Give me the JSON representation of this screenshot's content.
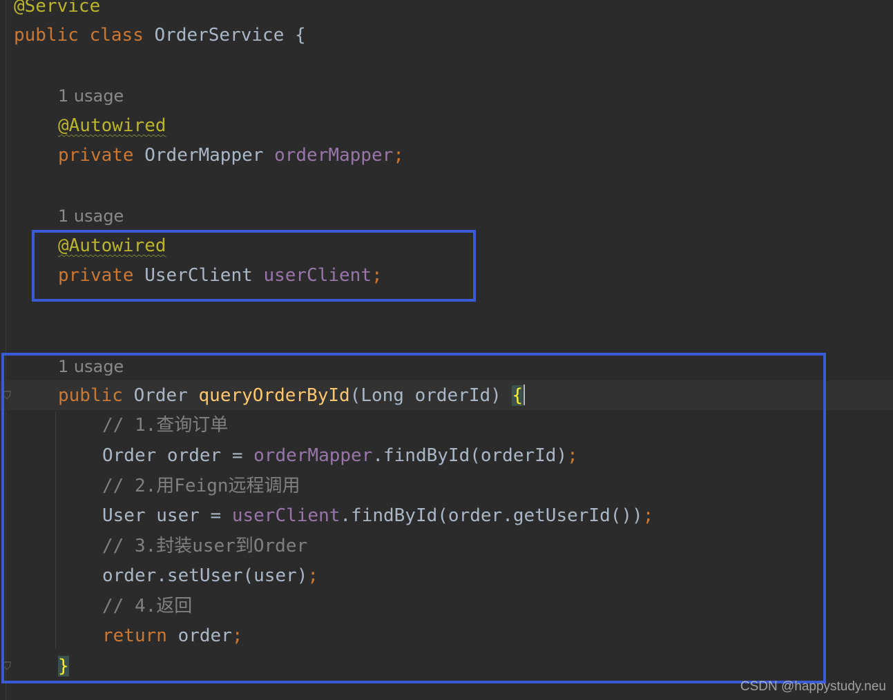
{
  "code": {
    "class_annotation": "@Service",
    "class_decl": {
      "mod": "public",
      "kw": "class",
      "name": "OrderService",
      "brace": "{"
    },
    "usage_hints": [
      "1 usage",
      "1 usage",
      "1 usage"
    ],
    "field1": {
      "annotation": "@Autowired",
      "mod": "private",
      "type": "OrderMapper",
      "name": "orderMapper",
      "semi": ";"
    },
    "field2": {
      "annotation": "@Autowired",
      "mod": "private",
      "type": "UserClient",
      "name": "userClient",
      "semi": ";"
    },
    "method": {
      "mod": "public",
      "ret": "Order",
      "name": "queryOrderById",
      "params": "(Long orderId) ",
      "open_brace": "{",
      "comment1": "// 1.查询订单",
      "stmt1": {
        "lhs": "Order order = ",
        "field": "orderMapper",
        "rest": ".findById(orderId)",
        "semi": ";"
      },
      "comment2": "// 2.用Feign远程调用",
      "stmt2": {
        "lhs": "User user = ",
        "field": "userClient",
        "rest": ".findById(order.getUserId())",
        "semi": ";"
      },
      "comment3": "// 3.封装user到Order",
      "stmt3": {
        "code": "order.setUser(user)",
        "semi": ";"
      },
      "comment4": "// 4.返回",
      "stmt4": {
        "kw": "return",
        "code": " order",
        "semi": ";"
      },
      "close_brace": "}"
    }
  },
  "watermark": "CSDN @happystudy.neu",
  "colors": {
    "highlight_box": "#3a5bd8",
    "background": "#2b2b2b"
  }
}
